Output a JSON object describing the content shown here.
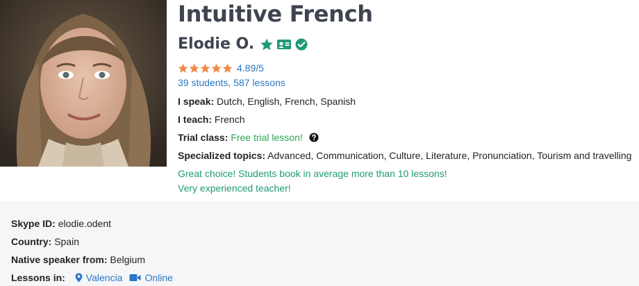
{
  "title": "Intuitive French",
  "teacher": {
    "name": "Elodie O.",
    "badges": [
      "star-badge-icon",
      "id-card-icon",
      "verified-check-icon"
    ]
  },
  "rating": {
    "stars": 5,
    "value": "4.89/5",
    "star_color": "#f08a4b"
  },
  "stats": "39 students, 587 lessons",
  "speak": {
    "label": "I speak:",
    "value": "Dutch, English, French, Spanish"
  },
  "teach": {
    "label": "I teach:",
    "value": "French"
  },
  "trial": {
    "label": "Trial class:",
    "value": "Free trial lesson!"
  },
  "topics": {
    "label": "Specialized topics:",
    "value": "Advanced, Communication, Culture, Literature, Pronunciation, Tourism and travelling"
  },
  "notes": [
    "Great choice! Students book in average more than 10 lessons!",
    "Very experienced teacher!"
  ],
  "details": {
    "skype": {
      "label": "Skype ID:",
      "value": "elodie.odent"
    },
    "country": {
      "label": "Country:",
      "value": "Spain"
    },
    "native": {
      "label": "Native speaker from:",
      "value": "Belgium"
    },
    "lessons": {
      "label": "Lessons in:",
      "place": "Valencia",
      "online": "Online"
    }
  },
  "colors": {
    "accent": "#1f9a78",
    "link": "#2a76c6",
    "green": "#2ea44f",
    "panel": "#f5f6f8"
  }
}
